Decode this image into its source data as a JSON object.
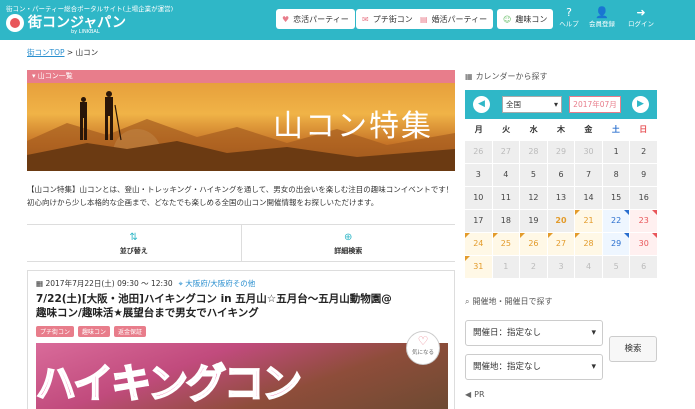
{
  "header": {
    "tagline": "街コン・パーティー総合ポータルサイト(上場企業が運営)",
    "logo_text": "街コンジャパン",
    "logo_sub": "by LINKBAL",
    "nav": [
      {
        "label": "恋活パーティー",
        "icon": "heart-icon"
      },
      {
        "label": "プチ街コン",
        "icon": "chat-icon"
      },
      {
        "label": "婚活パーティー",
        "icon": "document-icon"
      },
      {
        "label": "趣味コン",
        "icon": "smile-icon"
      }
    ],
    "icons": [
      {
        "label": "ヘルプ",
        "icon": "help-icon"
      },
      {
        "label": "会員登録",
        "icon": "user-icon"
      },
      {
        "label": "ログイン",
        "icon": "login-icon"
      }
    ]
  },
  "breadcrumb": {
    "home": "街コンTOP",
    "sep": ">",
    "current": "山コン"
  },
  "section_label": "山コン一覧",
  "hero_title": "山コン特集",
  "intro": "【山コン特集】山コンとは、登山・トレッキング・ハイキングを通して、男女の出会いを楽しむ注目の趣味コンイベントです！初心向けから少し本格的な企画まで、どなたでも楽しめる全国の山コン開催情報をお探しいただけます。",
  "controls": {
    "sort": "並び替え",
    "filter": "詳細検索"
  },
  "event": {
    "datetime": "2017年7月22日(土) 09:30 ～ 12:30",
    "location": "大阪府/大阪府その他",
    "title": "7/22(土)[大阪・池田]ハイキングコン in 五月山☆五月台～五月山動物園@趣味コン/趣味活★展望台まで男女でハイキング",
    "tags": [
      "プチ街コン",
      "趣味コン",
      "返金保証"
    ],
    "fav_label": "気になる",
    "photo_text": "ハイキングコン"
  },
  "calendar": {
    "heading": "カレンダーから探す",
    "region": "全国",
    "month": "2017年07月",
    "weekdays": [
      "月",
      "火",
      "水",
      "木",
      "金",
      "土",
      "日"
    ],
    "days": [
      {
        "d": "26",
        "t": "other"
      },
      {
        "d": "27",
        "t": "other"
      },
      {
        "d": "28",
        "t": "other"
      },
      {
        "d": "29",
        "t": "other"
      },
      {
        "d": "30",
        "t": "other"
      },
      {
        "d": "1",
        "t": ""
      },
      {
        "d": "2",
        "t": ""
      },
      {
        "d": "3",
        "t": ""
      },
      {
        "d": "4",
        "t": ""
      },
      {
        "d": "5",
        "t": ""
      },
      {
        "d": "6",
        "t": ""
      },
      {
        "d": "7",
        "t": ""
      },
      {
        "d": "8",
        "t": ""
      },
      {
        "d": "9",
        "t": ""
      },
      {
        "d": "10",
        "t": ""
      },
      {
        "d": "11",
        "t": ""
      },
      {
        "d": "12",
        "t": ""
      },
      {
        "d": "13",
        "t": ""
      },
      {
        "d": "14",
        "t": ""
      },
      {
        "d": "15",
        "t": ""
      },
      {
        "d": "16",
        "t": ""
      },
      {
        "d": "17",
        "t": ""
      },
      {
        "d": "18",
        "t": ""
      },
      {
        "d": "19",
        "t": ""
      },
      {
        "d": "20",
        "t": "today"
      },
      {
        "d": "21",
        "t": "ev"
      },
      {
        "d": "22",
        "t": "sat-ev"
      },
      {
        "d": "23",
        "t": "sun-ev"
      },
      {
        "d": "24",
        "t": "ev"
      },
      {
        "d": "25",
        "t": "ev"
      },
      {
        "d": "26",
        "t": "ev"
      },
      {
        "d": "27",
        "t": "ev"
      },
      {
        "d": "28",
        "t": "ev"
      },
      {
        "d": "29",
        "t": "sat-ev"
      },
      {
        "d": "30",
        "t": "sun-ev"
      },
      {
        "d": "31",
        "t": "ev"
      },
      {
        "d": "1",
        "t": "other"
      },
      {
        "d": "2",
        "t": "other"
      },
      {
        "d": "3",
        "t": "other"
      },
      {
        "d": "4",
        "t": "other"
      },
      {
        "d": "5",
        "t": "other"
      },
      {
        "d": "6",
        "t": "other"
      }
    ]
  },
  "search": {
    "heading": "開催地・開催日で探す",
    "date_select": "開催日：指定なし",
    "place_select": "開催地：指定なし",
    "button": "検索"
  },
  "pr_heading": "PR",
  "colors": {
    "brand": "#2fb7c7",
    "accent": "#e87d8b"
  }
}
